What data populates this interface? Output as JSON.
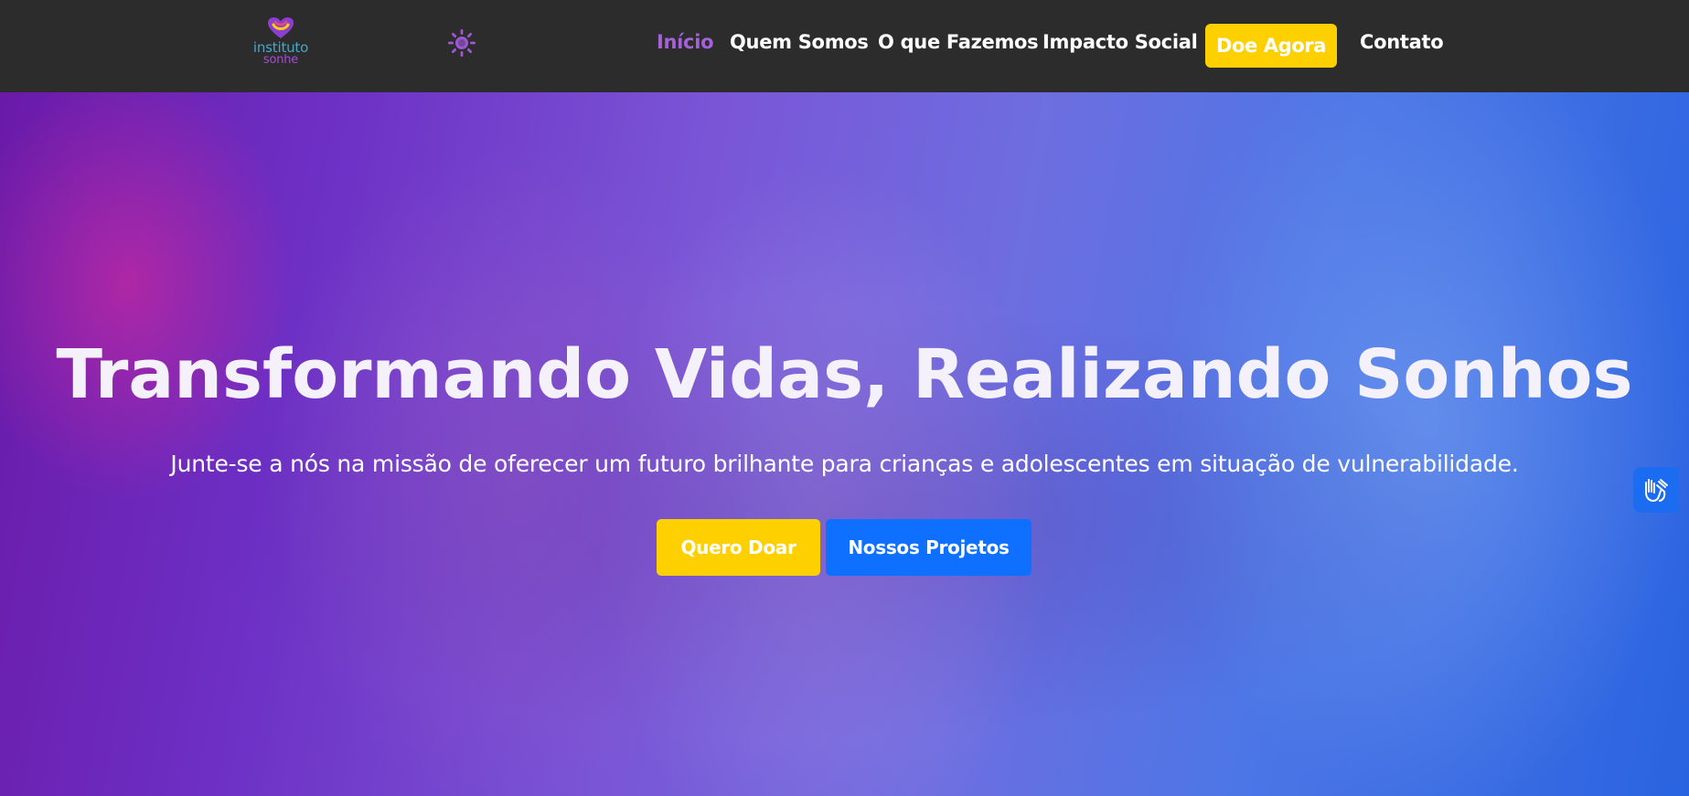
{
  "brand": {
    "line1": "instituto",
    "line2": "sonhe"
  },
  "colors": {
    "accent_purple": "#a562d8",
    "cta_yellow": "#ffd000",
    "cta_blue": "#0f70ff",
    "nav_bg": "#2c2c2c"
  },
  "header": {
    "theme_toggle_icon": "sun-icon",
    "nav": [
      {
        "label": "Início",
        "active": true
      },
      {
        "label": "Quem Somos"
      },
      {
        "label": "O que Fazemos"
      },
      {
        "label": "Impacto Social"
      },
      {
        "label": "Doe Agora",
        "cta": true
      },
      {
        "label": "Contato"
      }
    ]
  },
  "hero": {
    "title": "Transformando Vidas, Realizando Sonhos",
    "subtitle": "Junte-se a nós na missão de oferecer um futuro brilhante para crianças e adolescentes em situação de vulnerabilidade.",
    "primary_button": "Quero Doar",
    "secondary_button": "Nossos Projetos"
  },
  "accessibility_widget": {
    "icon": "sign-language-hands-icon"
  }
}
